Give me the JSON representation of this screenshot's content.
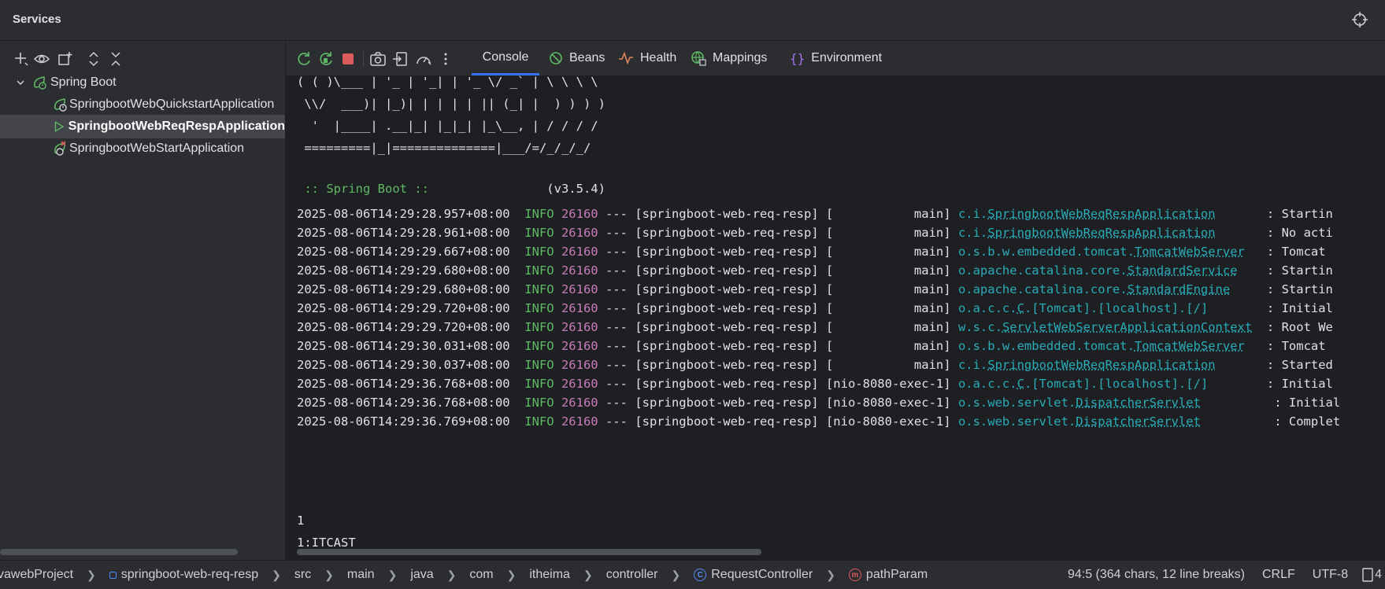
{
  "window": {
    "title": "Services"
  },
  "tree": {
    "root": "Spring Boot",
    "items": [
      {
        "label": "SpringbootWebQuickstartApplication",
        "state": "stopped"
      },
      {
        "label": "SpringbootWebReqRespApplication",
        "state": "running",
        "selected": true
      },
      {
        "label": "SpringbootWebStartApplication",
        "state": "error"
      }
    ]
  },
  "tabs": [
    {
      "label": "Console",
      "icon": "console",
      "active": true
    },
    {
      "label": "Beans",
      "icon": "beans-icon"
    },
    {
      "label": "Health",
      "icon": "health-icon"
    },
    {
      "label": "Mappings",
      "icon": "mappings-icon"
    },
    {
      "label": "Environment",
      "icon": "environment-icon"
    }
  ],
  "console": {
    "banner": [
      "( ( )\\___ | '_ | '_| | '_ \\/ _` | \\ \\ \\ \\",
      " \\\\/  ___)| |_)| | | | | || (_| |  ) ) ) )",
      "  '  |____| .__|_| |_|_| |_\\__, | / / / /",
      " =========|_|==============|___/=/_/_/_/"
    ],
    "spring_label": " :: Spring Boot ::",
    "spring_version": "(v3.5.4)",
    "logs": [
      {
        "ts": "2025-08-06T14:29:28.957+08:00",
        "level": "INFO",
        "pid": "26160",
        "app": "[springboot-web-req-resp]",
        "thread": "[           main]",
        "pkg": "c.i.",
        "cls": "SpringbootWebReqRespApplication",
        "pad": "      ",
        "msg": ": Startin"
      },
      {
        "ts": "2025-08-06T14:29:28.961+08:00",
        "level": "INFO",
        "pid": "26160",
        "app": "[springboot-web-req-resp]",
        "thread": "[           main]",
        "pkg": "c.i.",
        "cls": "SpringbootWebReqRespApplication",
        "pad": "      ",
        "msg": ": No acti"
      },
      {
        "ts": "2025-08-06T14:29:29.667+08:00",
        "level": "INFO",
        "pid": "26160",
        "app": "[springboot-web-req-resp]",
        "thread": "[           main]",
        "pkg": "o.s.b.w.embedded.tomcat.",
        "cls": "TomcatWebServer",
        "pad": "  ",
        "msg": ": Tomcat "
      },
      {
        "ts": "2025-08-06T14:29:29.680+08:00",
        "level": "INFO",
        "pid": "26160",
        "app": "[springboot-web-req-resp]",
        "thread": "[           main]",
        "pkg": "o.apache.catalina.core.",
        "cls": "StandardService",
        "pad": "   ",
        "msg": ": Startin"
      },
      {
        "ts": "2025-08-06T14:29:29.680+08:00",
        "level": "INFO",
        "pid": "26160",
        "app": "[springboot-web-req-resp]",
        "thread": "[           main]",
        "pkg": "o.apache.catalina.core.",
        "cls": "StandardEngine",
        "pad": "    ",
        "msg": ": Startin"
      },
      {
        "ts": "2025-08-06T14:29:29.720+08:00",
        "level": "INFO",
        "pid": "26160",
        "app": "[springboot-web-req-resp]",
        "thread": "[           main]",
        "pkg": "o.a.c.c.",
        "cls": "C",
        "pad": "",
        "tail": ".[Tomcat].[localhost].[/]       ",
        "msg": ": Initial"
      },
      {
        "ts": "2025-08-06T14:29:29.720+08:00",
        "level": "INFO",
        "pid": "26160",
        "app": "[springboot-web-req-resp]",
        "thread": "[           main]",
        "pkg": "w.s.c.",
        "cls": "ServletWebServerApplicationContext",
        "pad": " ",
        "msg": ": Root We"
      },
      {
        "ts": "2025-08-06T14:29:30.031+08:00",
        "level": "INFO",
        "pid": "26160",
        "app": "[springboot-web-req-resp]",
        "thread": "[           main]",
        "pkg": "o.s.b.w.embedded.tomcat.",
        "cls": "TomcatWebServer",
        "pad": "  ",
        "msg": ": Tomcat "
      },
      {
        "ts": "2025-08-06T14:29:30.037+08:00",
        "level": "INFO",
        "pid": "26160",
        "app": "[springboot-web-req-resp]",
        "thread": "[           main]",
        "pkg": "c.i.",
        "cls": "SpringbootWebReqRespApplication",
        "pad": "      ",
        "msg": ": Started"
      },
      {
        "ts": "2025-08-06T14:29:36.768+08:00",
        "level": "INFO",
        "pid": "26160",
        "app": "[springboot-web-req-resp]",
        "thread": "[nio-8080-exec-1]",
        "pkg": "o.a.c.c.",
        "cls": "C",
        "pad": "",
        "tail": ".[Tomcat].[localhost].[/]       ",
        "msg": ": Initial"
      },
      {
        "ts": "2025-08-06T14:29:36.768+08:00",
        "level": "INFO",
        "pid": "26160",
        "app": "[springboot-web-req-resp]",
        "thread": "[nio-8080-exec-1]",
        "pkg": "o.s.web.servlet.",
        "cls": "DispatcherServlet",
        "pad": "         ",
        "msg": ": Initial"
      },
      {
        "ts": "2025-08-06T14:29:36.769+08:00",
        "level": "INFO",
        "pid": "26160",
        "app": "[springboot-web-req-resp]",
        "thread": "[nio-8080-exec-1]",
        "pkg": "o.s.web.servlet.",
        "cls": "DispatcherServlet",
        "pad": "         ",
        "msg": ": Complet"
      }
    ],
    "output": [
      "1",
      "1:ITCAST"
    ]
  },
  "statusbar": {
    "crumbs": [
      "vawebProject",
      "springboot-web-req-resp",
      "src",
      "main",
      "java",
      "com",
      "itheima",
      "controller",
      "RequestController",
      "pathParam"
    ],
    "position": "94:5 (364 chars, 12 line breaks)",
    "line_sep": "CRLF",
    "encoding": "UTF-8",
    "extra": "4"
  },
  "colors": {
    "accent": "#3574f0",
    "info": "#5fb865",
    "pid": "#c77dbb",
    "logger": "#2aacb8",
    "stop": "#db5c5c"
  }
}
